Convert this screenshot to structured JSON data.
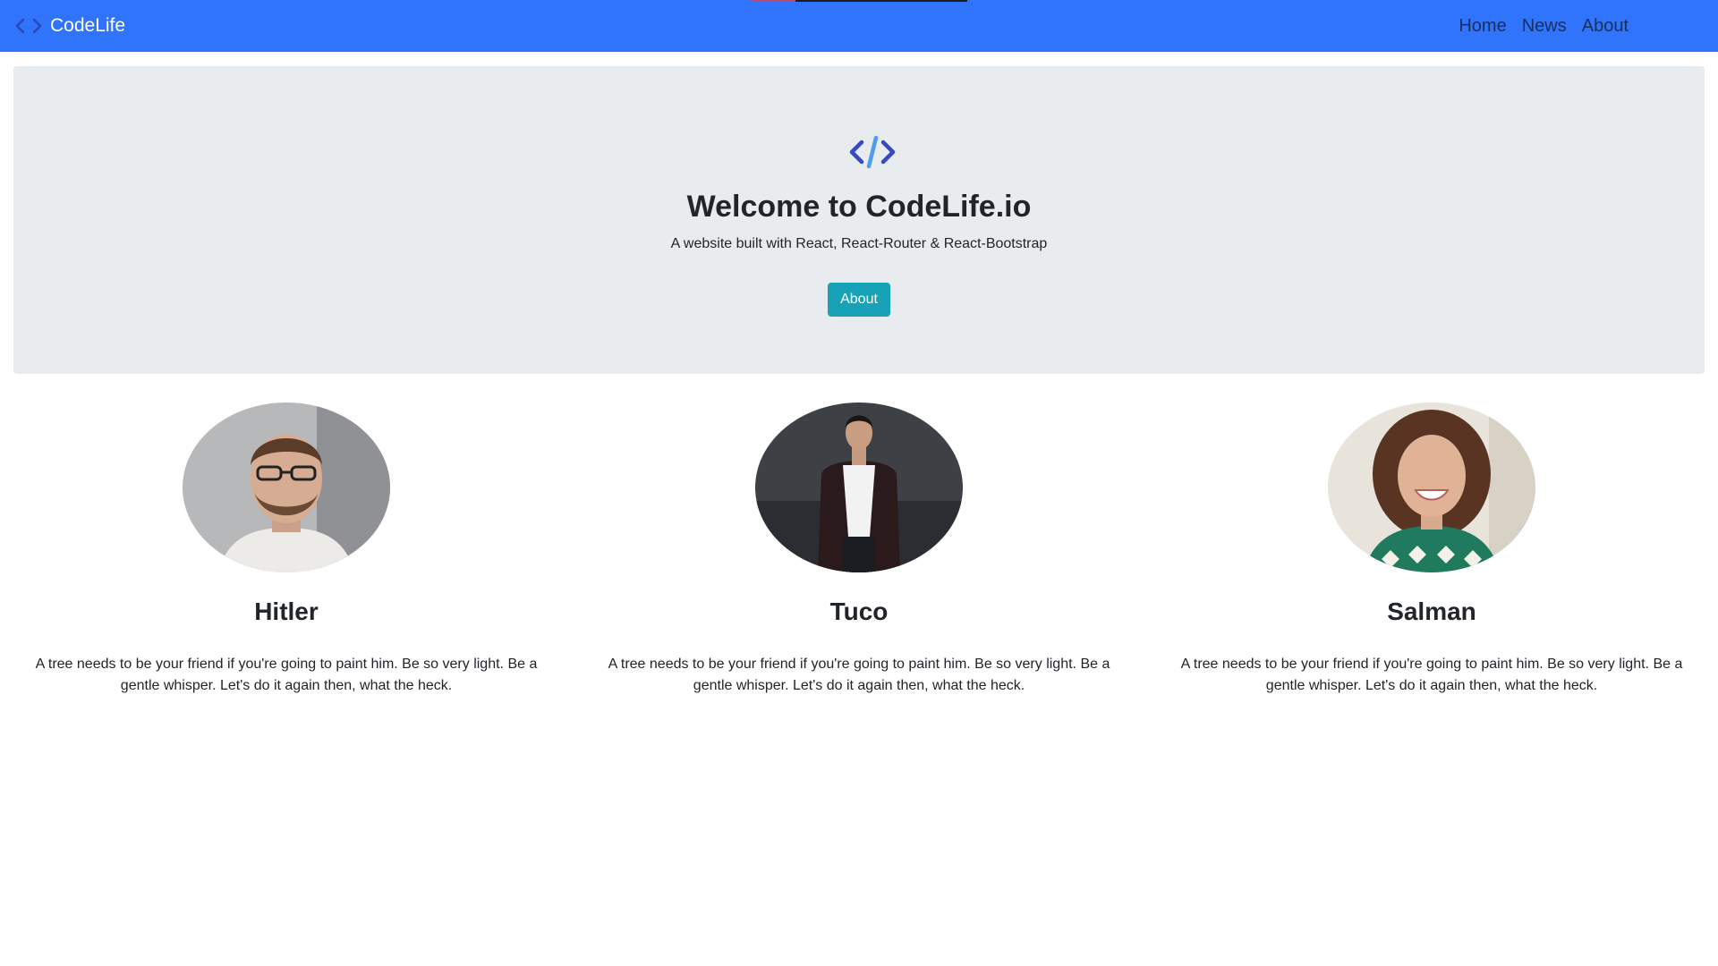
{
  "navbar": {
    "brand": {
      "icon": "code-icon",
      "name": "CodeLife"
    },
    "links": [
      {
        "label": "Home"
      },
      {
        "label": "News"
      },
      {
        "label": "About"
      }
    ],
    "background": "#2f74fb"
  },
  "hero": {
    "icon": "code-icon",
    "title": "Welcome to CodeLife.io",
    "subtitle": "A website built with React, React-Router & React-Bootstrap",
    "button_label": "About",
    "button_color": "#17a2b8",
    "background": "#e9ecef"
  },
  "people": [
    {
      "name": "Hitler",
      "photo": "man-with-glasses-photo",
      "text": "A tree needs to be your friend if you're going to paint him. Be so very light. Be a gentle whisper. Let's do it again then, what the heck."
    },
    {
      "name": "Tuco",
      "photo": "man-in-blazer-photo",
      "text": "A tree needs to be your friend if you're going to paint him. Be so very light. Be a gentle whisper. Let's do it again then, what the heck."
    },
    {
      "name": "Salman",
      "photo": "smiling-woman-photo",
      "text": "A tree needs to be your friend if you're going to paint him. Be so very light. Be a gentle whisper. Let's do it again then, what the heck."
    }
  ]
}
